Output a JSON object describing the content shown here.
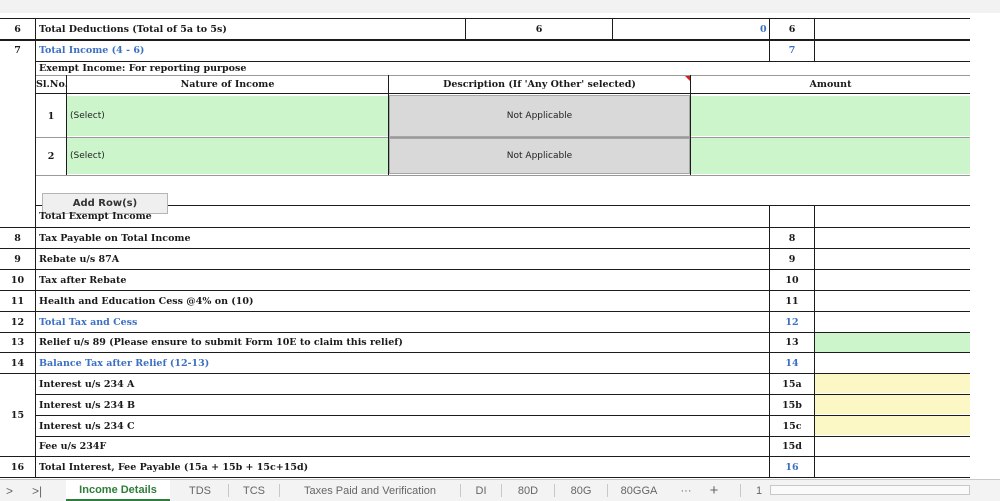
{
  "sheet": {
    "rows": [
      {
        "num": "6",
        "label": "Total Deductions (Total of 5a to 5s)",
        "mid": "6",
        "value": "0",
        "code": "6",
        "blue": false
      },
      {
        "num": "7",
        "label": "Total Income (4 - 6)",
        "code": "7",
        "blue": true
      },
      {
        "num": "8",
        "label": "Tax Payable on Total Income",
        "code": "8",
        "blue": false
      },
      {
        "num": "9",
        "label": "Rebate u/s 87A",
        "code": "9",
        "blue": false
      },
      {
        "num": "10",
        "label": "Tax after Rebate",
        "code": "10",
        "blue": false
      },
      {
        "num": "11",
        "label": "Health and Education Cess @4% on (10)",
        "code": "11",
        "blue": false
      },
      {
        "num": "12",
        "label": "Total Tax and Cess",
        "code": "12",
        "blue": true
      },
      {
        "num": "13",
        "label": "Relief u/s 89 (Please ensure to submit Form 10E to claim this relief)",
        "code": "13",
        "blue": false
      },
      {
        "num": "14",
        "label": "Balance Tax after Relief (12-13)",
        "code": "14",
        "blue": true
      },
      {
        "num": "16",
        "label": "Total Interest, Fee Payable (15a + 15b + 15c+15d)",
        "code": "16",
        "blue": false
      }
    ],
    "interest": {
      "num": "15",
      "items": [
        {
          "label": "Interest u/s 234 A",
          "code": "15a"
        },
        {
          "label": "Interest u/s 234 B",
          "code": "15b"
        },
        {
          "label": "Interest u/s 234 C",
          "code": "15c"
        },
        {
          "label": "Fee u/s 234F",
          "code": "15d"
        }
      ]
    },
    "exempt": {
      "title": "Exempt Income: For reporting purpose",
      "headers": {
        "slno": "Sl.No.",
        "nature": "Nature of Income",
        "description": "Description (If 'Any Other' selected)",
        "amount": "Amount"
      },
      "rows": [
        {
          "sl": "1",
          "nature": "(Select)",
          "description": "Not Applicable"
        },
        {
          "sl": "2",
          "nature": "(Select)",
          "description": "Not Applicable"
        }
      ],
      "add_row_label": "Add Row(s)",
      "total_label": "Total Exempt Income"
    }
  },
  "tabs": {
    "nav_prev": ">",
    "nav_last": ">|",
    "items": [
      "Income Details",
      "TDS",
      "TCS",
      "Taxes Paid and Verification",
      "DI",
      "80D",
      "80G",
      "80GGA"
    ],
    "active": "Income Details",
    "more": "···",
    "add": "+",
    "sheet_counter": "1"
  },
  "colors": {
    "input_green": "#ccf5cc",
    "input_yellow": "#fbf8c6",
    "label_blue": "#3a6fc4",
    "active_tab": "#2f7d3a"
  }
}
